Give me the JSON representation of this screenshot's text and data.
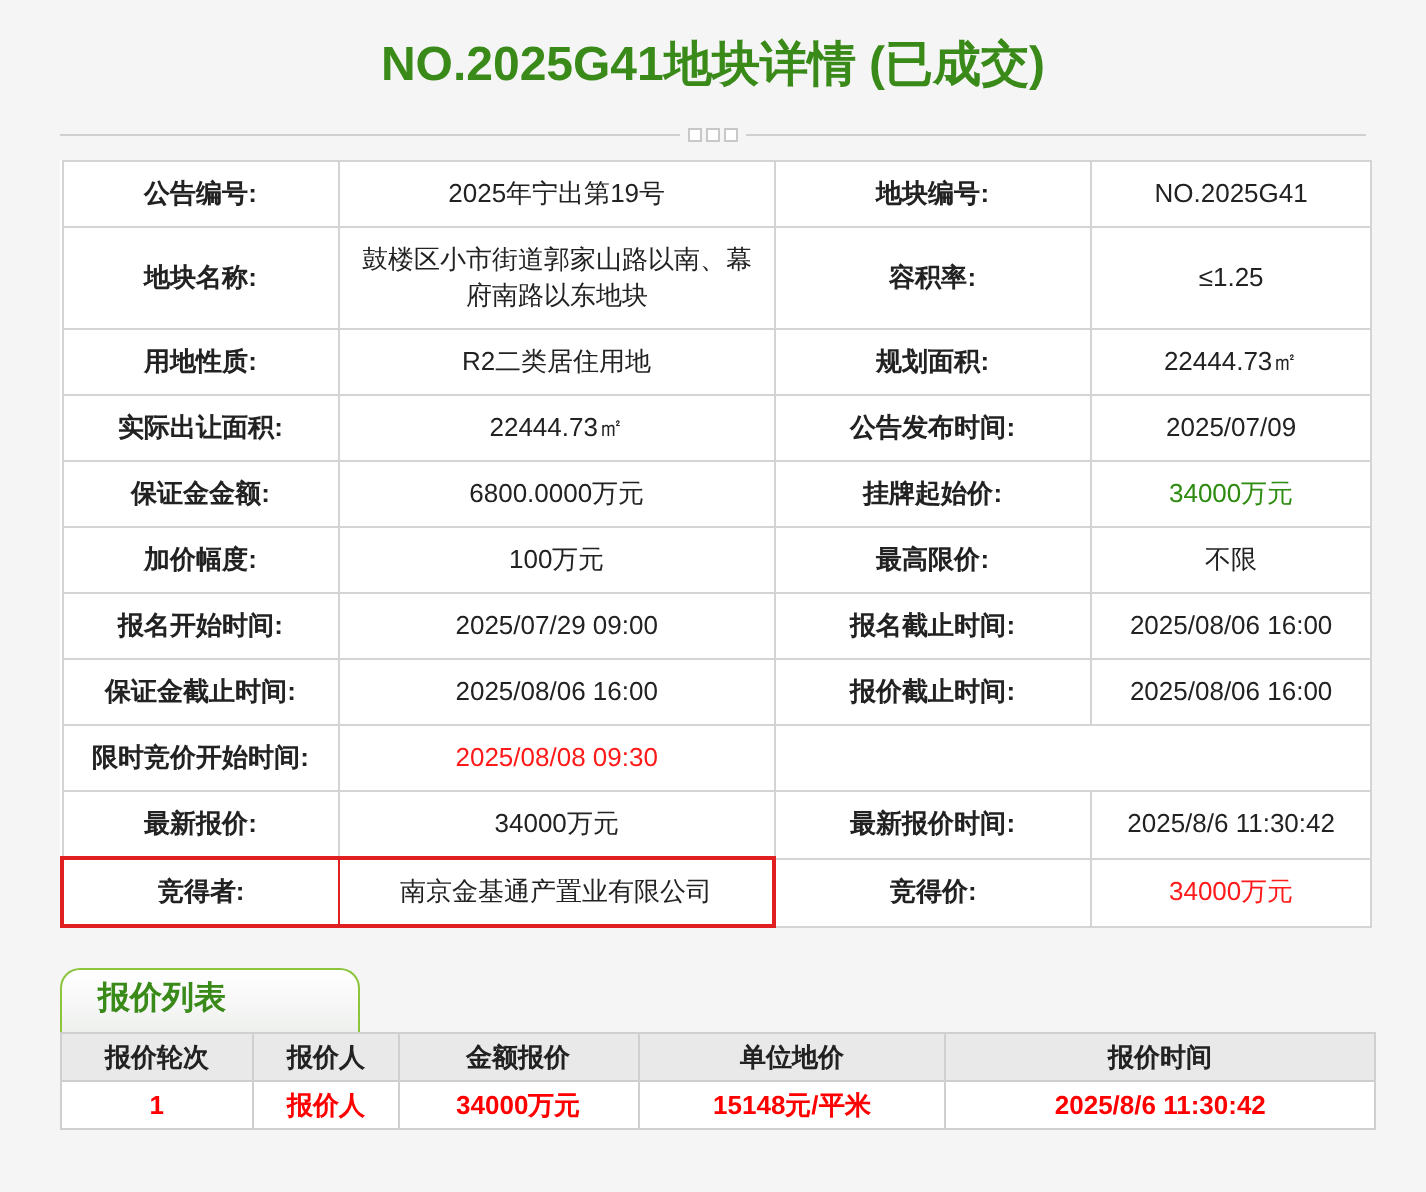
{
  "title": "NO.2025G41地块详情 (已成交)",
  "details": [
    [
      {
        "label": "公告编号:",
        "value": "2025年宁出第19号"
      },
      {
        "label": "地块编号:",
        "value": "NO.2025G41"
      }
    ],
    [
      {
        "label": "地块名称:",
        "value": "鼓楼区小市街道郭家山路以南、幕府南路以东地块"
      },
      {
        "label": "容积率:",
        "value": "≤1.25"
      }
    ],
    [
      {
        "label": "用地性质:",
        "value": "R2二类居住用地"
      },
      {
        "label": "规划面积:",
        "value": "22444.73㎡"
      }
    ],
    [
      {
        "label": "实际出让面积:",
        "value": "22444.73㎡"
      },
      {
        "label": "公告发布时间:",
        "value": "2025/07/09"
      }
    ],
    [
      {
        "label": "保证金金额:",
        "value": "6800.0000万元"
      },
      {
        "label": "挂牌起始价:",
        "value": "34000万元",
        "color": "#2e8b10"
      }
    ],
    [
      {
        "label": "加价幅度:",
        "value": "100万元"
      },
      {
        "label": "最高限价:",
        "value": "不限"
      }
    ],
    [
      {
        "label": "报名开始时间:",
        "value": "2025/07/29 09:00"
      },
      {
        "label": "报名截止时间:",
        "value": "2025/08/06 16:00"
      }
    ],
    [
      {
        "label": "保证金截止时间:",
        "value": "2025/08/06 16:00"
      },
      {
        "label": "报价截止时间:",
        "value": "2025/08/06 16:00"
      }
    ],
    [
      {
        "label": "限时竞价开始时间:",
        "value": "2025/08/08 09:30",
        "color": "#ff1a1a"
      }
    ],
    [
      {
        "label": "最新报价:",
        "value": "34000万元"
      },
      {
        "label": "最新报价时间:",
        "value": "2025/8/6 11:30:42"
      }
    ],
    [
      {
        "label": "竞得者:",
        "value": "南京金基通产置业有限公司",
        "outlined": true
      },
      {
        "label": "竞得价:",
        "value": "34000万元",
        "color": "#ff1a1a"
      }
    ]
  ],
  "bids": {
    "tab": "报价列表",
    "columns": [
      "报价轮次",
      "报价人",
      "金额报价",
      "单位地价",
      "报价时间"
    ],
    "rows": [
      [
        "1",
        "报价人",
        "34000万元",
        "15148元/平米",
        "2025/8/6 11:30:42"
      ]
    ]
  }
}
